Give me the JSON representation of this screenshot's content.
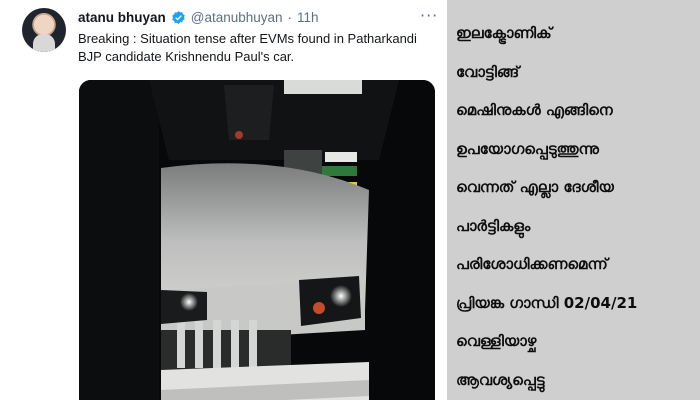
{
  "tweet": {
    "display_name": "atanu bhuyan",
    "handle": "@atanubhuyan",
    "separator": "·",
    "time": "11h",
    "more": "···",
    "text_lines": [
      "Breaking : Situation tense after EVMs found in Patharkandi",
      "BJP candidate Krishnendu Paul's car."
    ],
    "icons": {
      "avatar": "profile-photo",
      "verified": "verified-badge-icon",
      "more": "more-options-icon"
    },
    "verified_color": "#1da1f2"
  },
  "caption": {
    "lines": [
      "ഇലക്ട്രോണിക്",
      "വോട്ടിങ്ങ്",
      "മെഷിനുകൾ എങ്ങിനെ",
      "ഉപയോഗപ്പെടുത്തുന്നു",
      "വെന്നത് എല്ലാ ദേശീയ",
      "പാർട്ടികളും",
      "പരിശോധിക്കണമെന്ന്",
      "പ്രിയങ്ക ഗാന്ധി 02/04/21",
      "വെള്ളിയാഴ്ച",
      "ആവശ്യപ്പെട്ടു"
    ],
    "background": "#cfcfcf"
  }
}
